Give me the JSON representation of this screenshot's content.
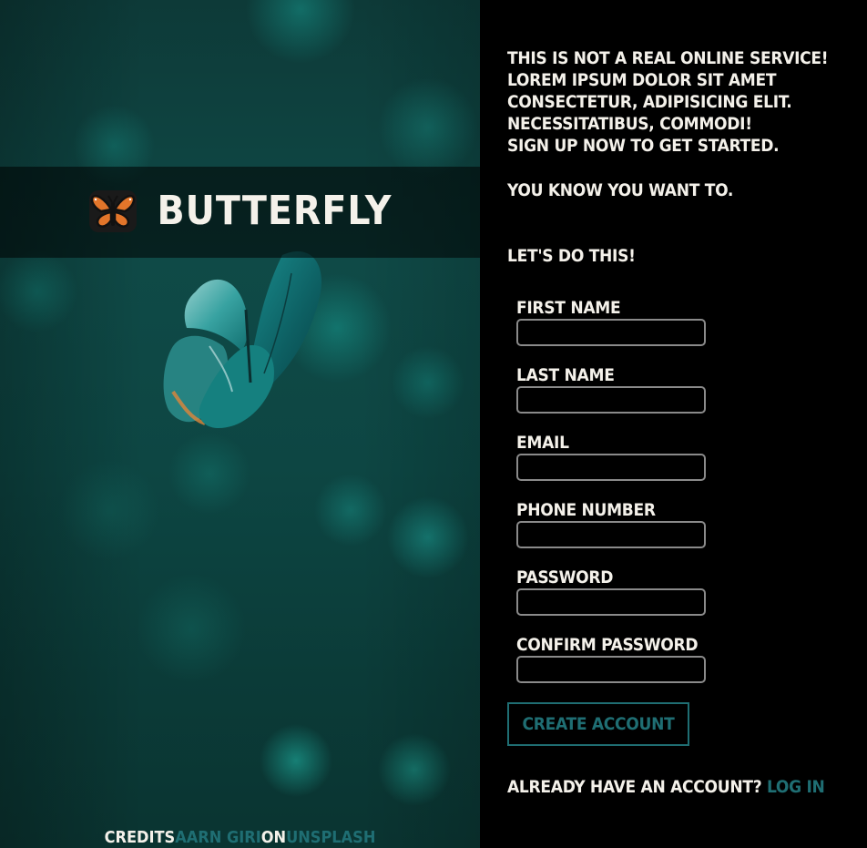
{
  "brand": {
    "name": "Butterfly",
    "logo_icon": "butterfly-icon"
  },
  "credits": {
    "label": "Credits",
    "photographer": "Aarn Giri",
    "on": "on",
    "site": "Unsplash"
  },
  "intro": {
    "line1": "This is not a real online service! Lorem ipsum dolor sit amet consectetur, adipisicing elit. Necessitatibus, commodi!",
    "line2": "Sign up now to get started.",
    "line3": "You know you want to.",
    "line4": "Let's do this!"
  },
  "form": {
    "fields": [
      {
        "label": "First Name",
        "value": ""
      },
      {
        "label": "Last Name",
        "value": ""
      },
      {
        "label": "Email",
        "value": ""
      },
      {
        "label": "Phone Number",
        "value": ""
      },
      {
        "label": "Password",
        "value": ""
      },
      {
        "label": "Confirm Password",
        "value": ""
      }
    ],
    "submit_label": "Create Account"
  },
  "login": {
    "prompt": "Already have an account?",
    "link": "Log in"
  },
  "colors": {
    "accent": "#1f6e73",
    "logo_orange": "#e2752a",
    "text": "#f4f1ea",
    "panel_bg": "#000000"
  }
}
